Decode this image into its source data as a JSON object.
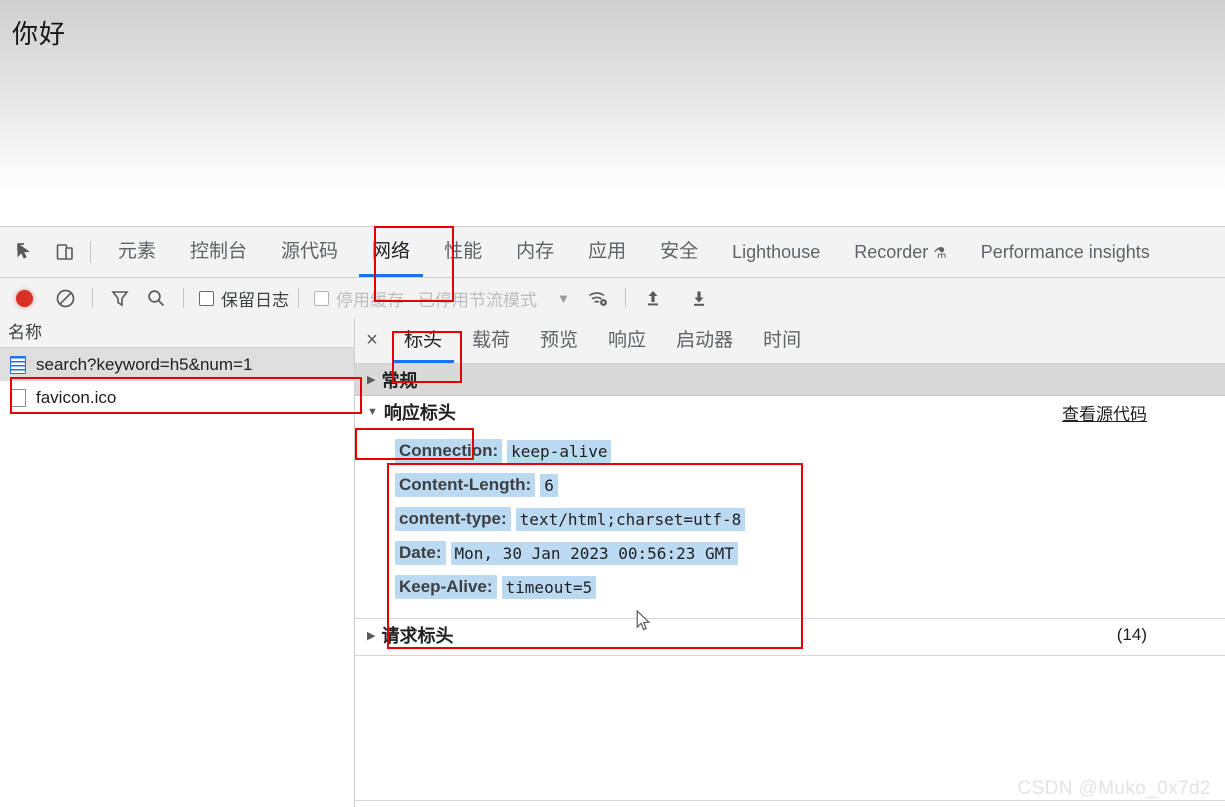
{
  "page": {
    "heading": "你好"
  },
  "devtools": {
    "left_icons": [
      {
        "name": "inspect-element-icon",
        "glyph": "inspect"
      },
      {
        "name": "device-toolbar-icon",
        "glyph": "device"
      }
    ],
    "tabs": [
      {
        "label": "元素",
        "active": false,
        "latin": false
      },
      {
        "label": "控制台",
        "active": false,
        "latin": false
      },
      {
        "label": "源代码",
        "active": false,
        "latin": false
      },
      {
        "label": "网络",
        "active": true,
        "latin": false
      },
      {
        "label": "性能",
        "active": false,
        "latin": false
      },
      {
        "label": "内存",
        "active": false,
        "latin": false
      },
      {
        "label": "应用",
        "active": false,
        "latin": false
      },
      {
        "label": "安全",
        "active": false,
        "latin": false
      },
      {
        "label": "Lighthouse",
        "active": false,
        "latin": true
      },
      {
        "label": "Recorder",
        "active": false,
        "latin": true,
        "beaker": "⚗"
      },
      {
        "label": "Performance insights",
        "active": false,
        "latin": true
      }
    ],
    "network_toolbar": {
      "record_title": "record-button",
      "clear_title": "clear-button",
      "filter_title": "filter-icon",
      "search_title": "search-icon",
      "preserve_log_label": "保留日志",
      "disable_cache_label": "停用缓存",
      "throttling_label": "已停用节流模式",
      "dropdown_glyph": "▼",
      "wifi_title": "network-conditions-icon",
      "upload_title": "import-har-icon",
      "download_title": "export-har-icon"
    }
  },
  "request_list": {
    "column_header": "名称",
    "rows": [
      {
        "name": "search?keyword=h5&num=1",
        "icon": "document-icon",
        "selected": true
      },
      {
        "name": "favicon.ico",
        "icon": "blank-file-icon",
        "selected": false
      }
    ]
  },
  "detail": {
    "close_label": "×",
    "tabs": [
      {
        "label": "标头",
        "active": true
      },
      {
        "label": "载荷",
        "active": false
      },
      {
        "label": "预览",
        "active": false
      },
      {
        "label": "响应",
        "active": false
      },
      {
        "label": "启动器",
        "active": false
      },
      {
        "label": "时间",
        "active": false
      }
    ],
    "general_section": {
      "title": "常规",
      "caret": "▶"
    },
    "response_section": {
      "title": "响应标头",
      "caret": "▼",
      "view_source_label": "查看源代码",
      "headers": [
        {
          "key": "Connection:",
          "value": "keep-alive"
        },
        {
          "key": "Content-Length:",
          "value": "6"
        },
        {
          "key": "content-type:",
          "value": "text/html;charset=utf-8"
        },
        {
          "key": "Date:",
          "value": "Mon, 30 Jan 2023 00:56:23 GMT"
        },
        {
          "key": "Keep-Alive:",
          "value": "timeout=5"
        }
      ]
    },
    "request_section": {
      "title": "请求标头",
      "caret": "▶",
      "count": "(14)"
    }
  },
  "annotations": {
    "color": "#e60000",
    "boxes": [
      {
        "name": "annotation-network-tab"
      },
      {
        "name": "annotation-request-row"
      },
      {
        "name": "annotation-headers-tab"
      },
      {
        "name": "annotation-response-headers-title"
      },
      {
        "name": "annotation-response-headers-body"
      }
    ]
  },
  "watermark": {
    "text": "CSDN @Muko_0x7d2"
  }
}
